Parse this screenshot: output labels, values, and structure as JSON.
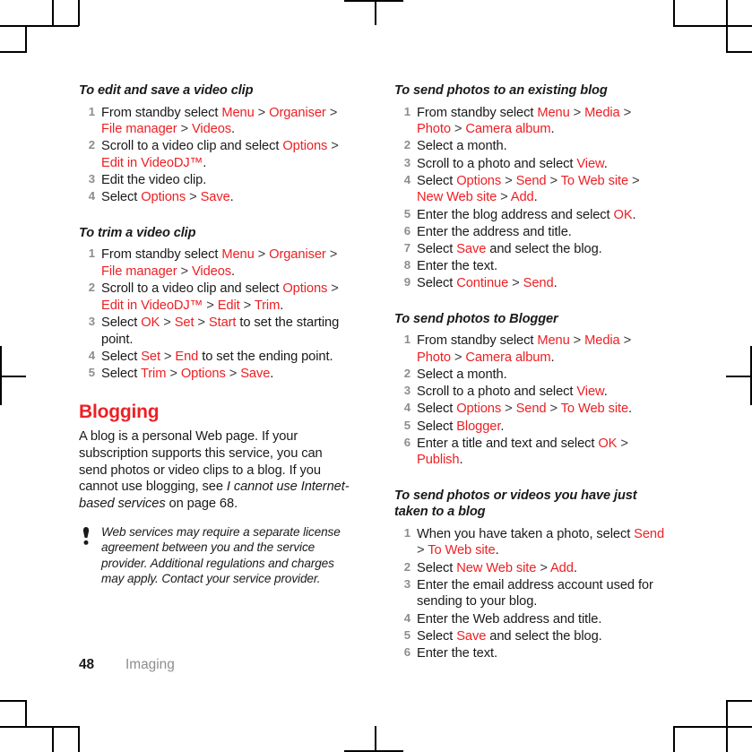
{
  "document": {
    "page_number": "48",
    "running_head": "Imaging",
    "accent_color": "#ED2024",
    "text_color": "#1a1a1a",
    "step_number_color": "#8d8d8d"
  },
  "left_column": {
    "blocks": [
      {
        "kind": "task-heading",
        "name": "heading-edit-save-video-clip",
        "text": "To edit and save a video clip"
      },
      {
        "kind": "steps",
        "name": "steps-edit-save-video-clip",
        "items": [
          [
            {
              "t": "From standby select "
            },
            {
              "t": "Menu",
              "kw": true
            },
            {
              "t": " > ",
              "gt": true
            },
            {
              "t": "Organiser",
              "kw": true
            },
            {
              "t": " > ",
              "gt": true
            },
            {
              "t": "File manager",
              "kw": true
            },
            {
              "t": " > ",
              "gt": true
            },
            {
              "t": "Videos",
              "kw": true
            },
            {
              "t": "."
            }
          ],
          [
            {
              "t": "Scroll to a video clip and select "
            },
            {
              "t": "Options",
              "kw": true
            },
            {
              "t": " > ",
              "gt": true
            },
            {
              "t": "Edit in VideoDJ™",
              "kw": true
            },
            {
              "t": "."
            }
          ],
          [
            {
              "t": "Edit the video clip."
            }
          ],
          [
            {
              "t": "Select "
            },
            {
              "t": "Options",
              "kw": true
            },
            {
              "t": " > ",
              "gt": true
            },
            {
              "t": "Save",
              "kw": true
            },
            {
              "t": "."
            }
          ]
        ]
      },
      {
        "kind": "task-heading",
        "name": "heading-trim-a-video-clip",
        "text": "To trim a video clip"
      },
      {
        "kind": "steps",
        "name": "steps-trim-a-video-clip",
        "items": [
          [
            {
              "t": "From standby select "
            },
            {
              "t": "Menu",
              "kw": true
            },
            {
              "t": " > ",
              "gt": true
            },
            {
              "t": "Organiser",
              "kw": true
            },
            {
              "t": " > ",
              "gt": true
            },
            {
              "t": "File manager",
              "kw": true
            },
            {
              "t": " > ",
              "gt": true
            },
            {
              "t": "Videos",
              "kw": true
            },
            {
              "t": "."
            }
          ],
          [
            {
              "t": "Scroll to a video clip and select "
            },
            {
              "t": "Options",
              "kw": true
            },
            {
              "t": " > ",
              "gt": true
            },
            {
              "t": "Edit in VideoDJ™",
              "kw": true
            },
            {
              "t": " > ",
              "gt": true
            },
            {
              "t": "Edit",
              "kw": true
            },
            {
              "t": " > ",
              "gt": true
            },
            {
              "t": "Trim",
              "kw": true
            },
            {
              "t": "."
            }
          ],
          [
            {
              "t": "Select "
            },
            {
              "t": "OK",
              "kw": true
            },
            {
              "t": " > ",
              "gt": true
            },
            {
              "t": "Set",
              "kw": true
            },
            {
              "t": " > ",
              "gt": true
            },
            {
              "t": "Start",
              "kw": true
            },
            {
              "t": " to set the starting point."
            }
          ],
          [
            {
              "t": "Select "
            },
            {
              "t": "Set",
              "kw": true
            },
            {
              "t": " > ",
              "gt": true
            },
            {
              "t": "End",
              "kw": true
            },
            {
              "t": " to set the ending point."
            }
          ],
          [
            {
              "t": "Select "
            },
            {
              "t": "Trim",
              "kw": true
            },
            {
              "t": " > ",
              "gt": true
            },
            {
              "t": "Options",
              "kw": true
            },
            {
              "t": " > ",
              "gt": true
            },
            {
              "t": "Save",
              "kw": true
            },
            {
              "t": "."
            }
          ]
        ]
      },
      {
        "kind": "section-heading",
        "name": "heading-blogging",
        "text": "Blogging"
      },
      {
        "kind": "paragraph",
        "name": "paragraph-blogging-intro",
        "runs": [
          {
            "t": "A blog is a personal Web page. If your subscription supports this service, you can send photos or video clips to a blog. If you cannot use blogging, see "
          },
          {
            "t": "I cannot use Internet-based services",
            "it": true
          },
          {
            "t": " on page 68."
          }
        ]
      },
      {
        "kind": "note",
        "name": "note-web-services",
        "icon": "exclamation-icon",
        "text": "Web services may require a separate license agreement between you and the service provider. Additional regulations and charges may apply. Contact your service provider."
      }
    ]
  },
  "right_column": {
    "blocks": [
      {
        "kind": "task-heading",
        "name": "heading-send-photos-existing-blog",
        "text": "To send photos to an existing blog"
      },
      {
        "kind": "steps",
        "name": "steps-send-photos-existing-blog",
        "items": [
          [
            {
              "t": "From standby select "
            },
            {
              "t": "Menu",
              "kw": true
            },
            {
              "t": " > ",
              "gt": true
            },
            {
              "t": "Media",
              "kw": true
            },
            {
              "t": " > ",
              "gt": true
            },
            {
              "t": "Photo",
              "kw": true
            },
            {
              "t": " > ",
              "gt": true
            },
            {
              "t": "Camera album",
              "kw": true
            },
            {
              "t": "."
            }
          ],
          [
            {
              "t": "Select a month."
            }
          ],
          [
            {
              "t": "Scroll to a photo and select "
            },
            {
              "t": "View",
              "kw": true
            },
            {
              "t": "."
            }
          ],
          [
            {
              "t": "Select "
            },
            {
              "t": "Options",
              "kw": true
            },
            {
              "t": " > ",
              "gt": true
            },
            {
              "t": "Send",
              "kw": true
            },
            {
              "t": " > ",
              "gt": true
            },
            {
              "t": "To Web site",
              "kw": true
            },
            {
              "t": " > ",
              "gt": true
            },
            {
              "t": "New Web site",
              "kw": true
            },
            {
              "t": " > ",
              "gt": true
            },
            {
              "t": "Add",
              "kw": true
            },
            {
              "t": "."
            }
          ],
          [
            {
              "t": "Enter the blog address and select "
            },
            {
              "t": "OK",
              "kw": true
            },
            {
              "t": "."
            }
          ],
          [
            {
              "t": "Enter the address and title."
            }
          ],
          [
            {
              "t": "Select "
            },
            {
              "t": "Save",
              "kw": true
            },
            {
              "t": " and select the blog."
            }
          ],
          [
            {
              "t": "Enter the text."
            }
          ],
          [
            {
              "t": "Select "
            },
            {
              "t": "Continue",
              "kw": true
            },
            {
              "t": " > ",
              "gt": true
            },
            {
              "t": "Send",
              "kw": true
            },
            {
              "t": "."
            }
          ]
        ]
      },
      {
        "kind": "task-heading",
        "name": "heading-send-photos-to-blogger",
        "text": "To send photos to Blogger"
      },
      {
        "kind": "steps",
        "name": "steps-send-photos-to-blogger",
        "items": [
          [
            {
              "t": "From standby select "
            },
            {
              "t": "Menu",
              "kw": true
            },
            {
              "t": " > ",
              "gt": true
            },
            {
              "t": "Media",
              "kw": true
            },
            {
              "t": " > ",
              "gt": true
            },
            {
              "t": "Photo",
              "kw": true
            },
            {
              "t": " > ",
              "gt": true
            },
            {
              "t": "Camera album",
              "kw": true
            },
            {
              "t": "."
            }
          ],
          [
            {
              "t": "Select a month."
            }
          ],
          [
            {
              "t": "Scroll to a photo and select "
            },
            {
              "t": "View",
              "kw": true
            },
            {
              "t": "."
            }
          ],
          [
            {
              "t": "Select "
            },
            {
              "t": "Options",
              "kw": true
            },
            {
              "t": " > ",
              "gt": true
            },
            {
              "t": "Send",
              "kw": true
            },
            {
              "t": " > ",
              "gt": true
            },
            {
              "t": "To Web site",
              "kw": true
            },
            {
              "t": "."
            }
          ],
          [
            {
              "t": "Select "
            },
            {
              "t": "Blogger",
              "kw": true
            },
            {
              "t": "."
            }
          ],
          [
            {
              "t": "Enter a title and text and select "
            },
            {
              "t": "OK",
              "kw": true
            },
            {
              "t": " > ",
              "gt": true
            },
            {
              "t": "Publish",
              "kw": true
            },
            {
              "t": "."
            }
          ]
        ]
      },
      {
        "kind": "task-heading",
        "name": "heading-send-photos-videos-just-taken",
        "text": "To send photos or videos you have just taken to a blog"
      },
      {
        "kind": "steps",
        "name": "steps-send-photos-videos-just-taken",
        "items": [
          [
            {
              "t": "When you have taken a photo, select "
            },
            {
              "t": "Send",
              "kw": true
            },
            {
              "t": " > ",
              "gt": true
            },
            {
              "t": "To Web site",
              "kw": true
            },
            {
              "t": "."
            }
          ],
          [
            {
              "t": "Select "
            },
            {
              "t": "New Web site",
              "kw": true
            },
            {
              "t": " > ",
              "gt": true
            },
            {
              "t": "Add",
              "kw": true
            },
            {
              "t": "."
            }
          ],
          [
            {
              "t": "Enter the email address account used for sending to your blog."
            }
          ],
          [
            {
              "t": "Enter the Web address and title."
            }
          ],
          [
            {
              "t": "Select "
            },
            {
              "t": "Save",
              "kw": true
            },
            {
              "t": " and select the blog."
            }
          ],
          [
            {
              "t": "Enter the text."
            }
          ]
        ]
      }
    ]
  },
  "crop_marks": {
    "name": "printer-crop-marks",
    "present": true
  }
}
